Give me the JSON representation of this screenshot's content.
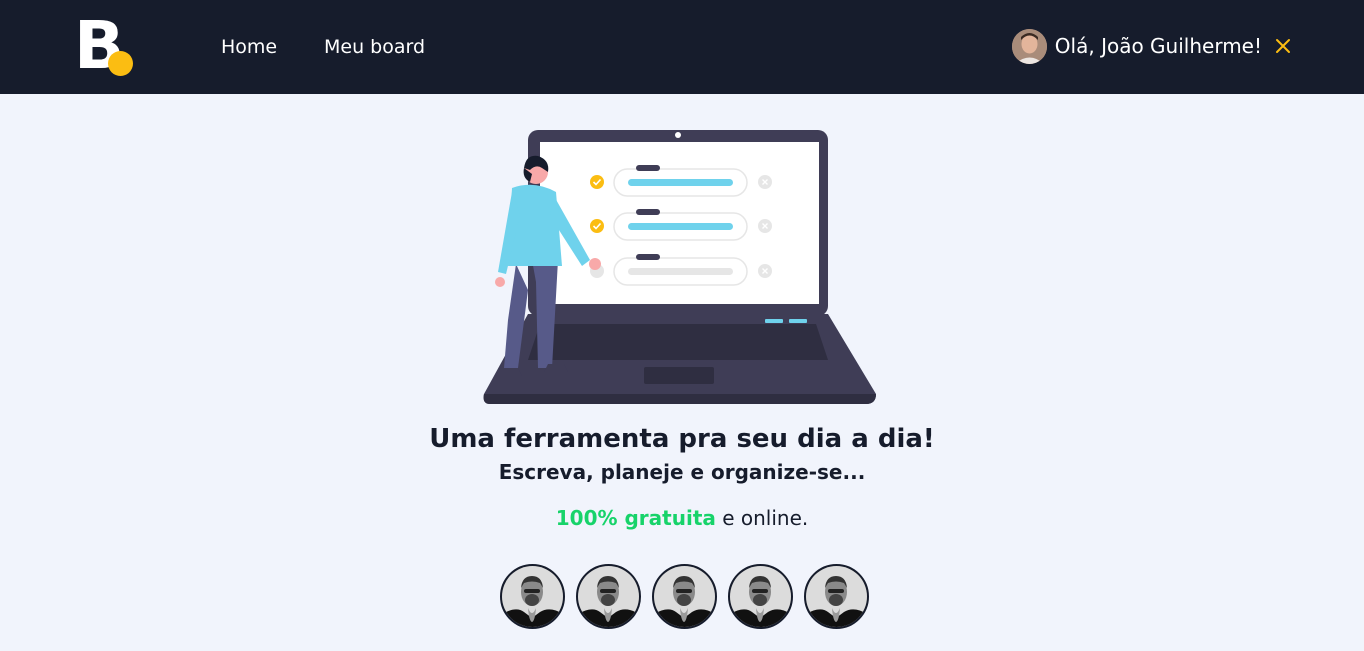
{
  "header": {
    "logo_letter": "B",
    "nav": [
      {
        "label": "Home"
      },
      {
        "label": "Meu board"
      }
    ],
    "user": {
      "greeting": "Olá, João Guilherme!"
    },
    "accent_color": "#fbbd12",
    "bg_color": "#161c2c"
  },
  "hero": {
    "headline": "Uma ferramenta pra seu dia a dia!",
    "subline": "Escreva, planeje e organize-se...",
    "tag_highlight": "100% gratuita",
    "tag_rest": " e online.",
    "highlight_color": "#17d36a"
  },
  "people": [
    {
      "icon": "portrait-photo"
    },
    {
      "icon": "portrait-photo"
    },
    {
      "icon": "portrait-photo"
    },
    {
      "icon": "portrait-photo"
    },
    {
      "icon": "portrait-photo"
    }
  ]
}
